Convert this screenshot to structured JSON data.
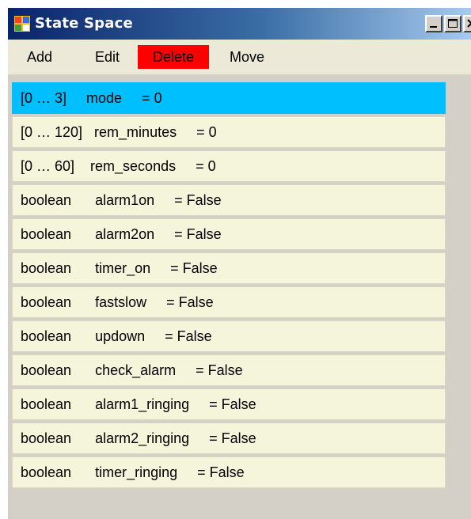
{
  "window": {
    "title": "State Space"
  },
  "menu": {
    "add": "Add",
    "edit": "Edit",
    "delete": "Delete",
    "move": "Move",
    "delete_highlight_color": "#ff0000"
  },
  "selected_color": "#00bfff",
  "row_color": "#f5f5dc",
  "variables": [
    {
      "text": "[0 … 3]     mode     = 0",
      "selected": true
    },
    {
      "text": "[0 … 120]   rem_minutes     = 0",
      "selected": false
    },
    {
      "text": "[0 … 60]    rem_seconds     = 0",
      "selected": false
    },
    {
      "text": "boolean      alarm1on     = False",
      "selected": false
    },
    {
      "text": "boolean      alarm2on     = False",
      "selected": false
    },
    {
      "text": "boolean      timer_on     = False",
      "selected": false
    },
    {
      "text": "boolean      fastslow     = False",
      "selected": false
    },
    {
      "text": "boolean      updown     = False",
      "selected": false
    },
    {
      "text": "boolean      check_alarm     = False",
      "selected": false
    },
    {
      "text": "boolean      alarm1_ringing     = False",
      "selected": false
    },
    {
      "text": "boolean      alarm2_ringing     = False",
      "selected": false
    },
    {
      "text": "boolean      timer_ringing     = False",
      "selected": false
    }
  ]
}
